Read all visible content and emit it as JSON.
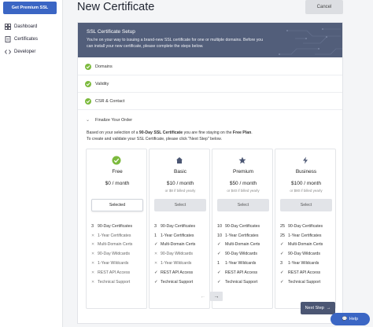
{
  "sidebar": {
    "premium_button": "Get Premium SSL",
    "items": [
      {
        "label": "Dashboard",
        "icon": "dashboard-icon"
      },
      {
        "label": "Certificates",
        "icon": "certificate-icon"
      },
      {
        "label": "Developer",
        "icon": "code-icon"
      }
    ]
  },
  "header": {
    "title": "New Certificate",
    "cancel_label": "Cancel"
  },
  "setup": {
    "title": "SSL Certificate Setup",
    "description": "You're on your way to issuing a brand-new SSL certificate for one or multiple domains. Before you can install your new certificate, please complete the steps below."
  },
  "steps": [
    {
      "label": "Domains",
      "status": "complete"
    },
    {
      "label": "Validity",
      "status": "complete"
    },
    {
      "label": "CSR & Contact",
      "status": "complete"
    }
  ],
  "finalize": {
    "label": "Finalize Your Order",
    "desc_line1_a": "Based on your selection of a ",
    "desc_line1_b": "90-Day SSL Certificate",
    "desc_line1_c": " you are fine staying on the ",
    "desc_line1_d": "Free Plan",
    "desc_line1_e": ".",
    "desc_line2": "To create and validate your SSL Certificate, please click \"Next Step\" below."
  },
  "plans": [
    {
      "name": "Free",
      "price": "$0 / month",
      "yearly": "",
      "button": "Selected",
      "selected": true,
      "icon": "check-circle-icon",
      "features": [
        {
          "qty": "3",
          "label": "90-Day Certificates",
          "on": true
        },
        {
          "qty": "",
          "label": "1-Year Certificates",
          "on": false
        },
        {
          "qty": "",
          "label": "Multi-Domain Certs",
          "on": false
        },
        {
          "qty": "",
          "label": "90-Day Wildcards",
          "on": false
        },
        {
          "qty": "",
          "label": "1-Year Wildcards",
          "on": false
        },
        {
          "qty": "",
          "label": "REST API Access",
          "on": false
        },
        {
          "qty": "",
          "label": "Technical Support",
          "on": false
        }
      ]
    },
    {
      "name": "Basic",
      "price": "$10 / month",
      "yearly": "or $8 if billed yearly",
      "button": "Select",
      "selected": false,
      "icon": "home-icon",
      "features": [
        {
          "qty": "3",
          "label": "90-Day Certificates",
          "on": true
        },
        {
          "qty": "1",
          "label": "1-Year Certificates",
          "on": true
        },
        {
          "qty": "",
          "label": "Multi-Domain Certs",
          "on": true
        },
        {
          "qty": "",
          "label": "90-Day Wildcards",
          "on": false
        },
        {
          "qty": "",
          "label": "1-Year Wildcards",
          "on": false
        },
        {
          "qty": "",
          "label": "REST API Access",
          "on": true
        },
        {
          "qty": "",
          "label": "Technical Support",
          "on": true
        }
      ]
    },
    {
      "name": "Premium",
      "price": "$50 / month",
      "yearly": "or $40 if billed yearly",
      "button": "Select",
      "selected": false,
      "icon": "star-icon",
      "features": [
        {
          "qty": "10",
          "label": "90-Day Certificates",
          "on": true
        },
        {
          "qty": "10",
          "label": "1-Year Certificates",
          "on": true
        },
        {
          "qty": "",
          "label": "Multi-Domain Certs",
          "on": true
        },
        {
          "qty": "",
          "label": "90-Day Wildcards",
          "on": true
        },
        {
          "qty": "1",
          "label": "1-Year Wildcards",
          "on": true
        },
        {
          "qty": "",
          "label": "REST API Access",
          "on": true
        },
        {
          "qty": "",
          "label": "Technical Support",
          "on": true
        }
      ]
    },
    {
      "name": "Business",
      "price": "$100 / month",
      "yearly": "or $80 if billed yearly",
      "button": "Select",
      "selected": false,
      "icon": "bolt-icon",
      "features": [
        {
          "qty": "25",
          "label": "90-Day Certificates",
          "on": true
        },
        {
          "qty": "25",
          "label": "1-Year Certificates",
          "on": true
        },
        {
          "qty": "",
          "label": "Multi-Domain Certs",
          "on": true
        },
        {
          "qty": "",
          "label": "90-Day Wildcards",
          "on": true
        },
        {
          "qty": "3",
          "label": "1-Year Wildcards",
          "on": true
        },
        {
          "qty": "",
          "label": "REST API Access",
          "on": true
        },
        {
          "qty": "",
          "label": "Technical Support",
          "on": true
        }
      ]
    }
  ],
  "footer": {
    "next_step_label": "Next Step",
    "chat_label": "Help"
  },
  "colors": {
    "accent": "#3b66c4",
    "banner": "#525e7a",
    "success": "#7cba3d",
    "next_step": "#4b5673"
  }
}
